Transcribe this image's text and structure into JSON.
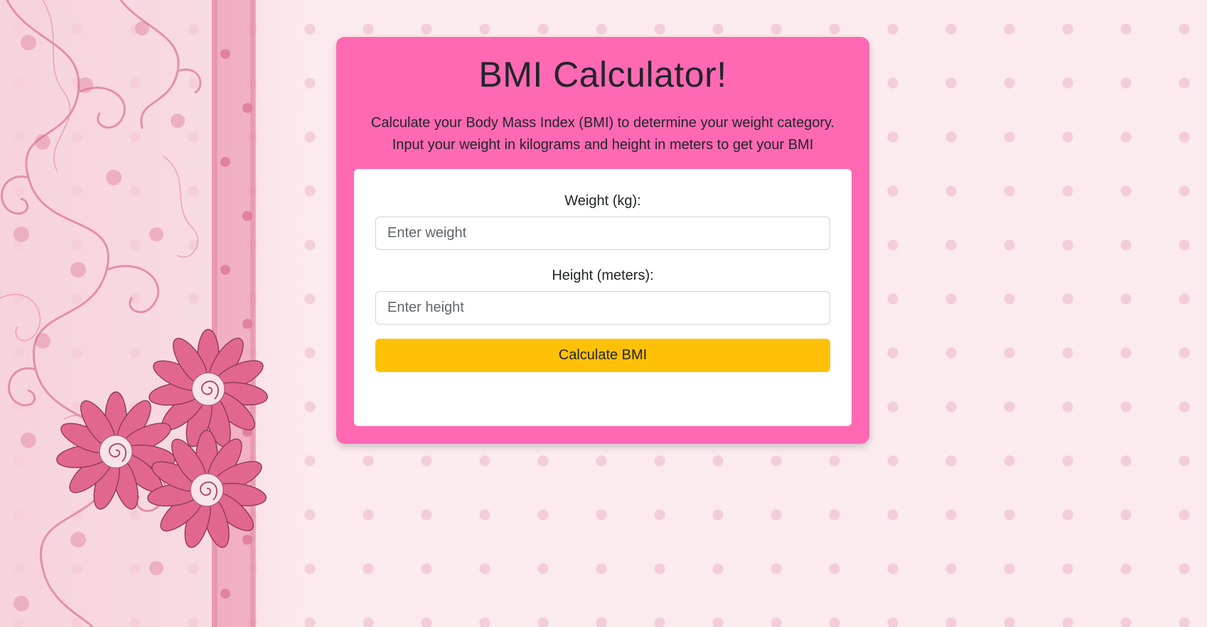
{
  "app": {
    "title": "BMI Calculator!",
    "description": "Calculate your Body Mass Index (BMI) to determine your weight category. Input your weight in kilograms and height in meters to get your BMI"
  },
  "form": {
    "weight_label": "Weight (kg):",
    "weight_placeholder": "Enter weight",
    "weight_value": "",
    "height_label": "Height (meters):",
    "height_placeholder": "Enter height",
    "height_value": "",
    "submit_label": "Calculate BMI"
  },
  "colors": {
    "card_background": "#ff69b4",
    "button_background": "#ffc107",
    "page_background": "#fbeaee",
    "flower": "#e2678f"
  },
  "decor": {
    "background": "pink-polka-dot-pattern",
    "left_ornament": "swirl-and-flower-border"
  }
}
